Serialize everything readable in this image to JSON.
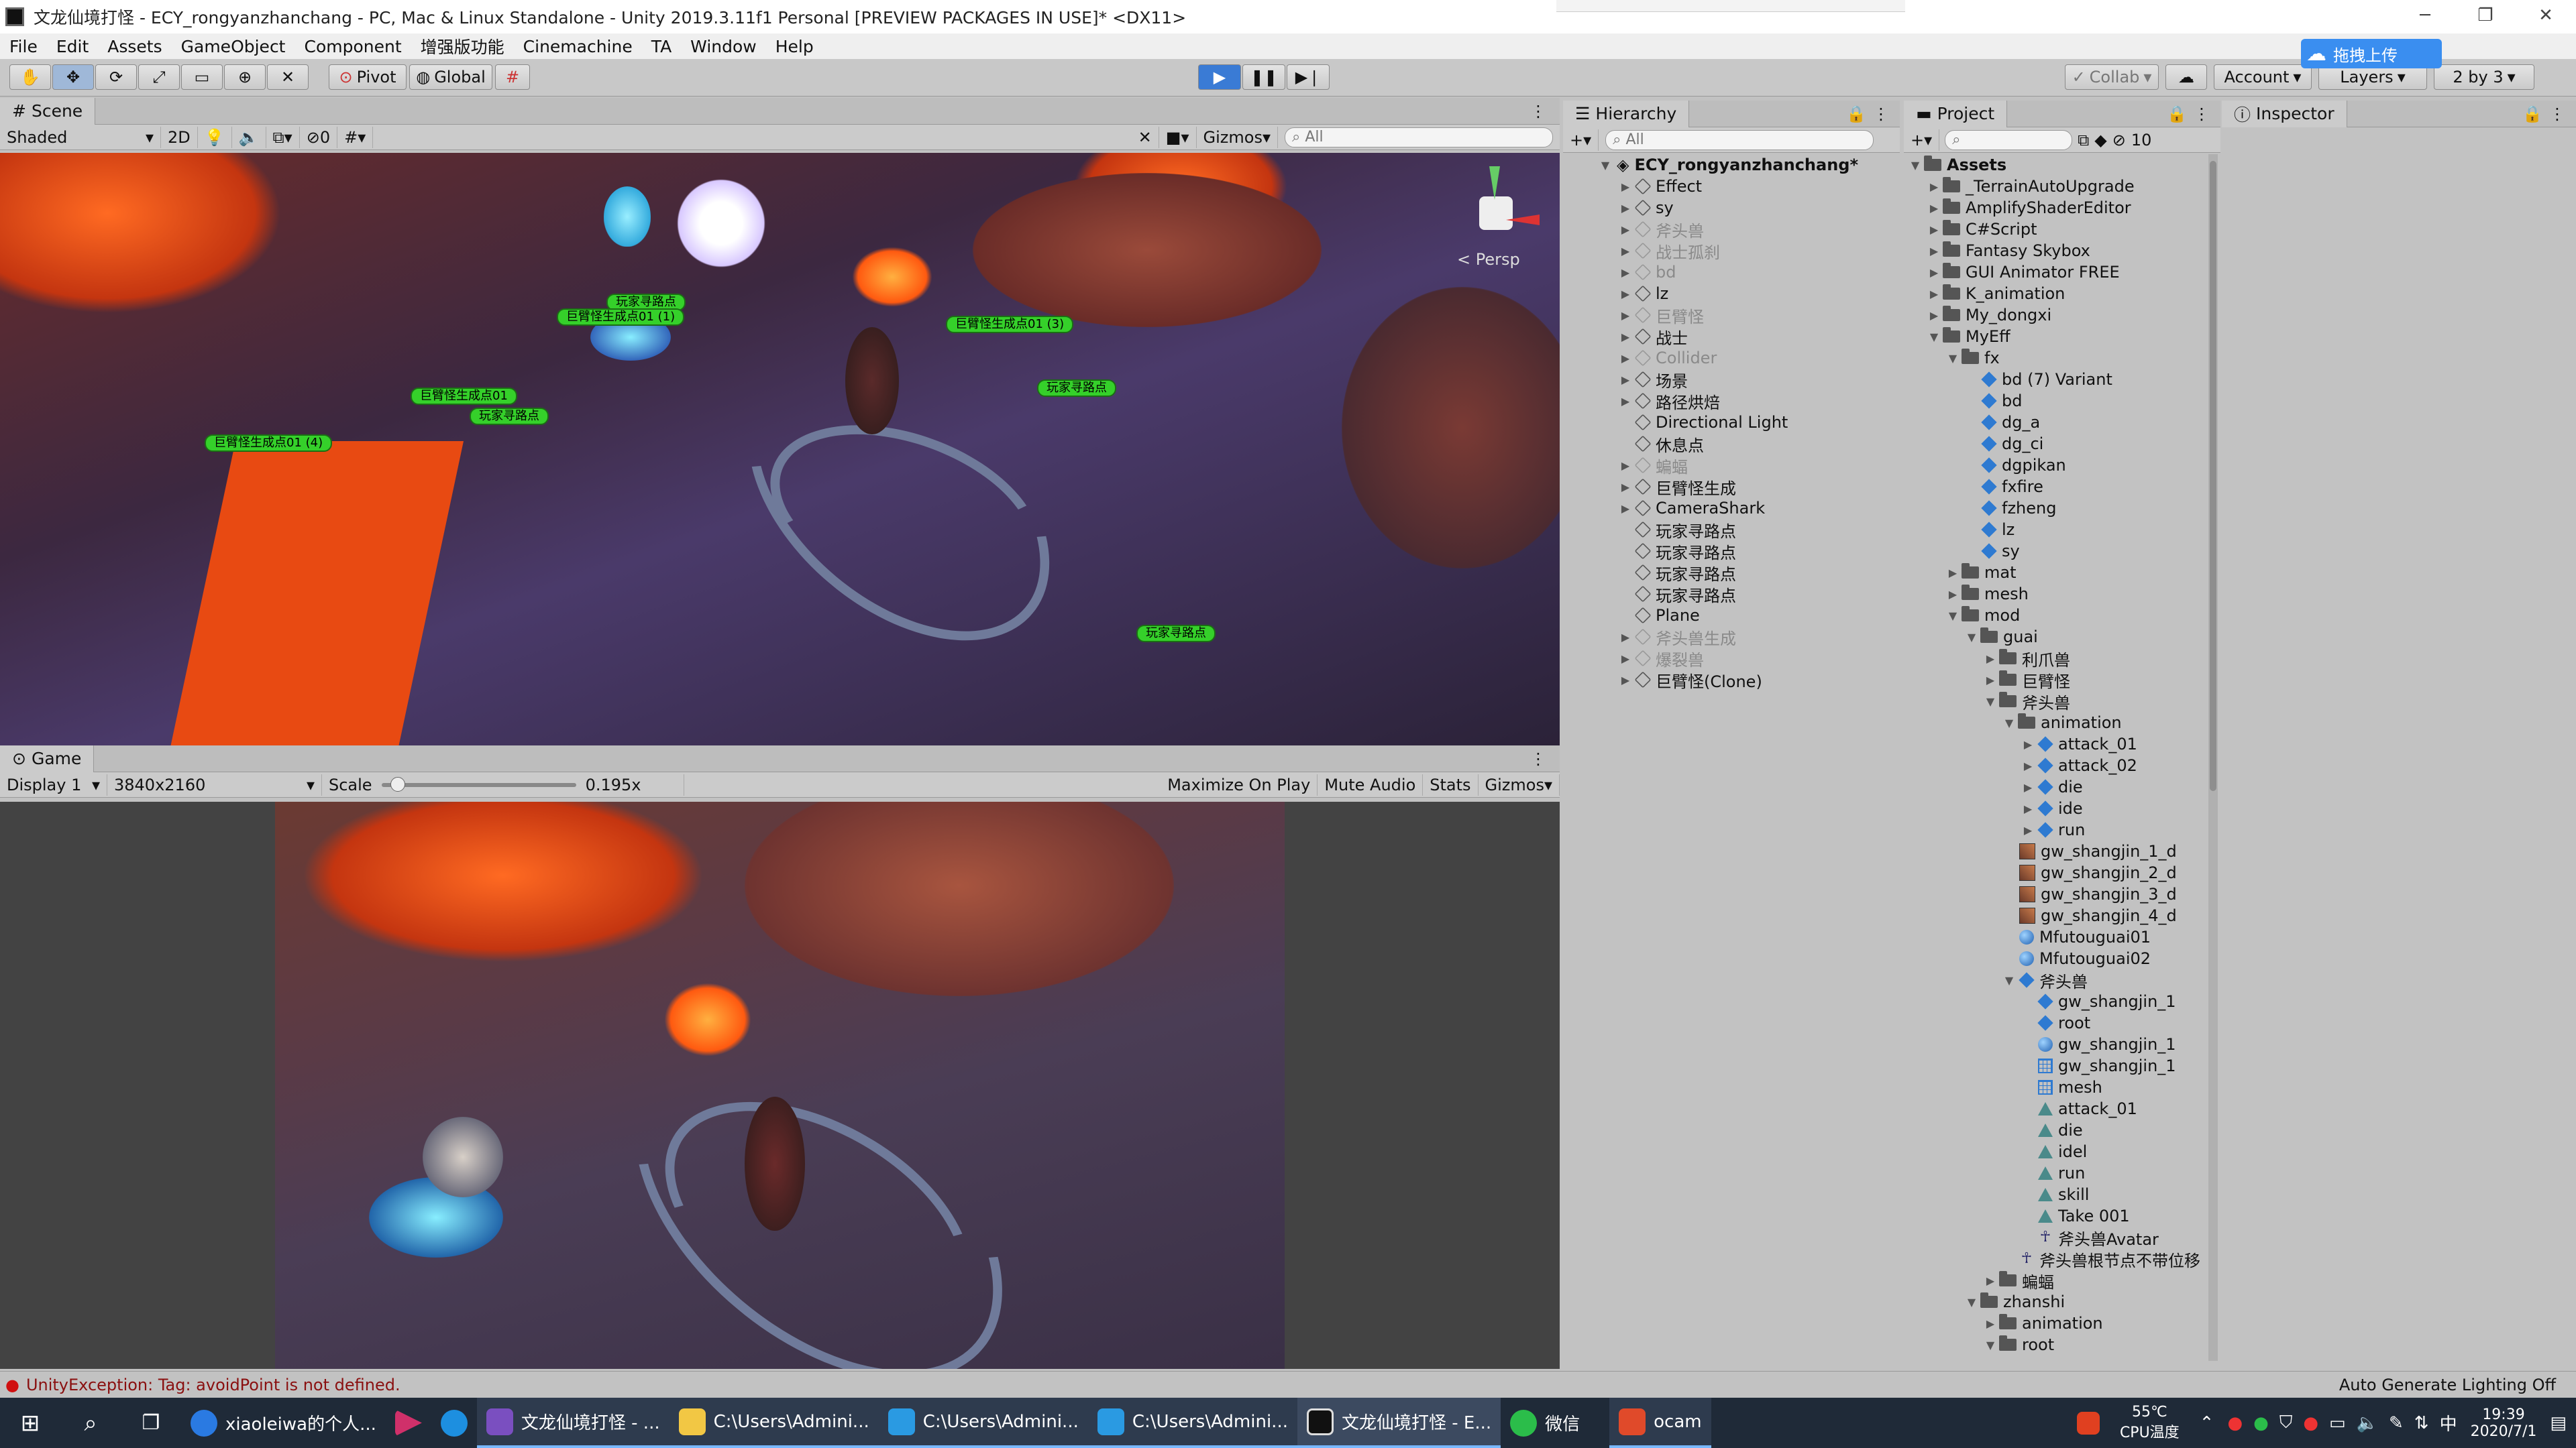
{
  "window": {
    "title": "文龙仙境打怪 - ECY_rongyanzhanchang - PC, Mac & Linux Standalone - Unity 2019.3.11f1 Personal [PREVIEW PACKAGES IN USE]* <DX11>"
  },
  "menu": [
    "File",
    "Edit",
    "Assets",
    "GameObject",
    "Component",
    "增强版功能",
    "Cinemachine",
    "TA",
    "Window",
    "Help"
  ],
  "toolbar": {
    "pivot": "Pivot",
    "global": "Global",
    "collab": "Collab",
    "account": "Account",
    "layers": "Layers",
    "layout": "2 by 3",
    "upload": "拖拽上传"
  },
  "scene": {
    "tab": "Scene",
    "shading": "Shaded",
    "mode2d": "2D",
    "hidden_count": "0",
    "gizmos": "Gizmos",
    "search_placeholder": "All",
    "persp": "< Persp",
    "labels": [
      "玩家寻路点",
      "巨臂怪生成点01 (1)",
      "巨臂怪生成点01 (3)",
      "巨臂怪生成点01",
      "玩家寻路点",
      "玩家寻路点",
      "巨臂怪生成点01 (4)",
      "玩家寻路点"
    ]
  },
  "game": {
    "tab": "Game",
    "display": "Display 1",
    "resolution": "3840x2160",
    "scale_label": "Scale",
    "scale_value": "0.195x",
    "scale_level": 0.05,
    "maximize": "Maximize On Play",
    "mute": "Mute Audio",
    "stats": "Stats",
    "gizmos": "Gizmos"
  },
  "hierarchy": {
    "tab": "Hierarchy",
    "search_placeholder": "All",
    "root": "ECY_rongyanzhanchang*",
    "items": [
      {
        "label": "Effect",
        "dim": false,
        "arrow": true
      },
      {
        "label": "sy",
        "dim": false,
        "arrow": true
      },
      {
        "label": "斧头兽",
        "dim": true,
        "arrow": true
      },
      {
        "label": "战士孤刹",
        "dim": true,
        "arrow": true
      },
      {
        "label": "bd",
        "dim": true,
        "arrow": true
      },
      {
        "label": "lz",
        "dim": false,
        "arrow": true
      },
      {
        "label": "巨臂怪",
        "dim": true,
        "arrow": true
      },
      {
        "label": "战士",
        "dim": false,
        "arrow": true
      },
      {
        "label": "Collider",
        "dim": true,
        "arrow": true
      },
      {
        "label": "场景",
        "dim": false,
        "arrow": true
      },
      {
        "label": "路径烘焙",
        "dim": false,
        "arrow": true
      },
      {
        "label": "Directional Light",
        "dim": false,
        "arrow": false
      },
      {
        "label": "休息点",
        "dim": false,
        "arrow": false
      },
      {
        "label": "蝙蝠",
        "dim": true,
        "arrow": true
      },
      {
        "label": "巨臂怪生成",
        "dim": false,
        "arrow": true
      },
      {
        "label": "CameraShark",
        "dim": false,
        "arrow": true
      },
      {
        "label": "玩家寻路点",
        "dim": false,
        "arrow": false
      },
      {
        "label": "玩家寻路点",
        "dim": false,
        "arrow": false
      },
      {
        "label": "玩家寻路点",
        "dim": false,
        "arrow": false
      },
      {
        "label": "玩家寻路点",
        "dim": false,
        "arrow": false
      },
      {
        "label": "Plane",
        "dim": false,
        "arrow": false
      },
      {
        "label": "斧头兽生成",
        "dim": true,
        "arrow": true
      },
      {
        "label": "爆裂兽",
        "dim": true,
        "arrow": true
      },
      {
        "label": "巨臂怪(Clone)",
        "dim": false,
        "arrow": true
      }
    ]
  },
  "project": {
    "tab": "Project",
    "hidden_count": "10",
    "root": "Assets",
    "items": [
      {
        "label": "_TerrainAutoUpgrade",
        "lvl": 1,
        "icon": "folder",
        "arrow": "▶"
      },
      {
        "label": "AmplifyShaderEditor",
        "lvl": 1,
        "icon": "folder",
        "arrow": "▶"
      },
      {
        "label": "C#Script",
        "lvl": 1,
        "icon": "folder",
        "arrow": "▶"
      },
      {
        "label": "Fantasy Skybox",
        "lvl": 1,
        "icon": "folder",
        "arrow": "▶"
      },
      {
        "label": "GUI Animator FREE",
        "lvl": 1,
        "icon": "folder",
        "arrow": "▶"
      },
      {
        "label": "K_animation",
        "lvl": 1,
        "icon": "folder",
        "arrow": "▶"
      },
      {
        "label": "My_dongxi",
        "lvl": 1,
        "icon": "folder",
        "arrow": "▶"
      },
      {
        "label": "MyEff",
        "lvl": 1,
        "icon": "folder",
        "arrow": "▼"
      },
      {
        "label": "fx",
        "lvl": 2,
        "icon": "folder",
        "arrow": "▼"
      },
      {
        "label": "bd (7) Variant",
        "lvl": 3,
        "icon": "pfb",
        "arrow": ""
      },
      {
        "label": "bd",
        "lvl": 3,
        "icon": "pfb",
        "arrow": ""
      },
      {
        "label": "dg_a",
        "lvl": 3,
        "icon": "pfb",
        "arrow": ""
      },
      {
        "label": "dg_ci",
        "lvl": 3,
        "icon": "pfb",
        "arrow": ""
      },
      {
        "label": "dgpikan",
        "lvl": 3,
        "icon": "pfb",
        "arrow": ""
      },
      {
        "label": "fxfire",
        "lvl": 3,
        "icon": "pfb",
        "arrow": ""
      },
      {
        "label": "fzheng",
        "lvl": 3,
        "icon": "pfb",
        "arrow": ""
      },
      {
        "label": "lz",
        "lvl": 3,
        "icon": "pfb",
        "arrow": ""
      },
      {
        "label": "sy",
        "lvl": 3,
        "icon": "pfb",
        "arrow": ""
      },
      {
        "label": "mat",
        "lvl": 2,
        "icon": "folder",
        "arrow": "▶"
      },
      {
        "label": "mesh",
        "lvl": 2,
        "icon": "folder",
        "arrow": "▶"
      },
      {
        "label": "mod",
        "lvl": 2,
        "icon": "folder",
        "arrow": "▼"
      },
      {
        "label": "guai",
        "lvl": 3,
        "icon": "folder",
        "arrow": "▼"
      },
      {
        "label": "利爪兽",
        "lvl": 4,
        "icon": "folder",
        "arrow": "▶"
      },
      {
        "label": "巨臂怪",
        "lvl": 4,
        "icon": "folder",
        "arrow": "▶"
      },
      {
        "label": "斧头兽",
        "lvl": 4,
        "icon": "folder",
        "arrow": "▼"
      },
      {
        "label": "animation",
        "lvl": 5,
        "icon": "folder",
        "arrow": "▼"
      },
      {
        "label": "attack_01",
        "lvl": 6,
        "icon": "pfb",
        "arrow": "▶"
      },
      {
        "label": "attack_02",
        "lvl": 6,
        "icon": "pfb",
        "arrow": "▶"
      },
      {
        "label": "die",
        "lvl": 6,
        "icon": "pfb",
        "arrow": "▶"
      },
      {
        "label": "ide",
        "lvl": 6,
        "icon": "pfb",
        "arrow": "▶"
      },
      {
        "label": "run",
        "lvl": 6,
        "icon": "pfb",
        "arrow": "▶"
      },
      {
        "label": "gw_shangjin_1_d",
        "lvl": 5,
        "icon": "tex",
        "arrow": ""
      },
      {
        "label": "gw_shangjin_2_d",
        "lvl": 5,
        "icon": "tex",
        "arrow": ""
      },
      {
        "label": "gw_shangjin_3_d",
        "lvl": 5,
        "icon": "tex",
        "arrow": ""
      },
      {
        "label": "gw_shangjin_4_d",
        "lvl": 5,
        "icon": "tex",
        "arrow": ""
      },
      {
        "label": "Mfutouguai01",
        "lvl": 5,
        "icon": "mat",
        "arrow": ""
      },
      {
        "label": "Mfutouguai02",
        "lvl": 5,
        "icon": "mat",
        "arrow": ""
      },
      {
        "label": "斧头兽",
        "lvl": 5,
        "icon": "pfb",
        "arrow": "▼"
      },
      {
        "label": "gw_shangjin_1",
        "lvl": 6,
        "icon": "pfb",
        "arrow": ""
      },
      {
        "label": "root",
        "lvl": 6,
        "icon": "pfb",
        "arrow": ""
      },
      {
        "label": "gw_shangjin_1",
        "lvl": 6,
        "icon": "mat",
        "arrow": ""
      },
      {
        "label": "gw_shangjin_1",
        "lvl": 6,
        "icon": "mesh",
        "arrow": ""
      },
      {
        "label": "mesh",
        "lvl": 6,
        "icon": "mesh",
        "arrow": ""
      },
      {
        "label": "attack_01",
        "lvl": 6,
        "icon": "anim",
        "arrow": ""
      },
      {
        "label": "die",
        "lvl": 6,
        "icon": "anim",
        "arrow": ""
      },
      {
        "label": "idel",
        "lvl": 6,
        "icon": "anim",
        "arrow": ""
      },
      {
        "label": "run",
        "lvl": 6,
        "icon": "anim",
        "arrow": ""
      },
      {
        "label": "skill",
        "lvl": 6,
        "icon": "anim",
        "arrow": ""
      },
      {
        "label": "Take 001",
        "lvl": 6,
        "icon": "anim",
        "arrow": ""
      },
      {
        "label": "斧头兽Avatar",
        "lvl": 6,
        "icon": "avatar",
        "arrow": ""
      },
      {
        "label": "斧头兽根节点不带位移",
        "lvl": 5,
        "icon": "avatar",
        "arrow": ""
      },
      {
        "label": "蝙蝠",
        "lvl": 4,
        "icon": "folder",
        "arrow": "▶"
      },
      {
        "label": "zhanshi",
        "lvl": 3,
        "icon": "folder",
        "arrow": "▼"
      },
      {
        "label": "animation",
        "lvl": 4,
        "icon": "folder",
        "arrow": "▶"
      },
      {
        "label": "root",
        "lvl": 4,
        "icon": "folder",
        "arrow": "▼"
      }
    ]
  },
  "inspector": {
    "tab": "Inspector"
  },
  "status": {
    "error": "UnityException: Tag: avoidPoint is not defined.",
    "lighting": "Auto Generate Lighting Off"
  },
  "taskbar": {
    "apps": [
      "xiaoleiwa的个人...",
      "",
      "",
      "文龙仙境打怪 - ...",
      "C:\\Users\\Admini...",
      "C:\\Users\\Admini...",
      "C:\\Users\\Admini...",
      "文龙仙境打怪 - E...",
      "微信",
      "ocam"
    ],
    "temp": "55℃",
    "cpu": "CPU温度",
    "time": "19:39",
    "date": "2020/7/1",
    "ime": "中"
  },
  "colors": {
    "accent": "#3a7bd5",
    "error": "#d01010",
    "label_green": "#35d02a",
    "taskbar": "#1f2a38"
  }
}
